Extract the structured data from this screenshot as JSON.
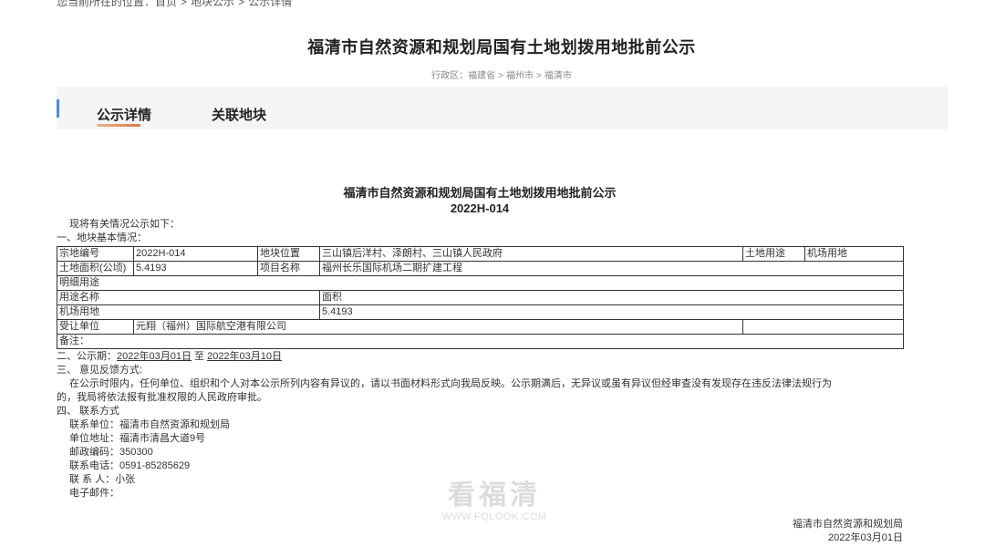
{
  "breadcrumb": {
    "prefix": "您当前所在的位置：",
    "items": [
      "首页",
      "地块公示",
      "公示详情"
    ],
    "separator": ">"
  },
  "page_title": "福清市自然资源和规划局国有土地划拨用地批前公示",
  "region": {
    "label": "行政区：",
    "items": [
      "福建省",
      "福州市",
      "福清市"
    ],
    "separator": ">"
  },
  "tabs": [
    {
      "label": "公示详情",
      "active": true
    },
    {
      "label": "关联地块",
      "active": false
    }
  ],
  "notice": {
    "title": "福清市自然资源和规划局国有土地划拨用地批前公示",
    "code": "2022H-014",
    "intro": "现将有关情况公示如下：",
    "section1": "一、地块基本情况：",
    "table": {
      "parcel_no_label": "宗地编号",
      "parcel_no": "2022H-014",
      "location_label": "地块位置",
      "location": "三山镇后洋村、泽朗村、三山镇人民政府",
      "use_label": "土地用途",
      "use": "机场用地",
      "area_label": "土地面积(公顷)",
      "area": "5.4193",
      "project_label": "项目名称",
      "project": "福州长乐国际机场二期扩建工程",
      "detail_label": "明细用途",
      "use_name_header": "用途名称",
      "area_header": "面积",
      "detail_use": "机场用地",
      "detail_area": "5.4193",
      "assignee_label": "受让单位",
      "assignee": "元翔（福州）国际航空港有限公司",
      "remark_label": "备注："
    },
    "section2_prefix": "二、公示期：",
    "period_start": "2022年03月01日",
    "period_to": "至",
    "period_end": "2022年03月10日",
    "section3": "三、 意见反馈方式:",
    "feedback_line1": "在公示时限内，任何单位、组织和个人对本公示所列内容有异议的，请以书面材料形式向我局反映。公示期满后，无异议或虽有异议但经审查没有发现存在违反法律法规行为",
    "feedback_line2": "的，我局将依法报有批准权限的人民政府审批。",
    "section4": "四、 联系方式",
    "contacts": [
      "联系单位：福清市自然资源和规划局",
      "单位地址：福清市清昌大道9号",
      "邮政编码：350300",
      "联系电话：0591-85285629",
      "联 系 人：小张",
      "电子邮件："
    ],
    "sign_org": "福清市自然资源和规划局",
    "sign_date": "2022年03月01日"
  },
  "watermark": {
    "text": "看福清",
    "url": "WWW.FQLOOK.COM"
  },
  "colors": {
    "accent_bar": "#4a90d9",
    "tab_underline": "#d97a45",
    "tab_bg": "#f5f5f5"
  }
}
